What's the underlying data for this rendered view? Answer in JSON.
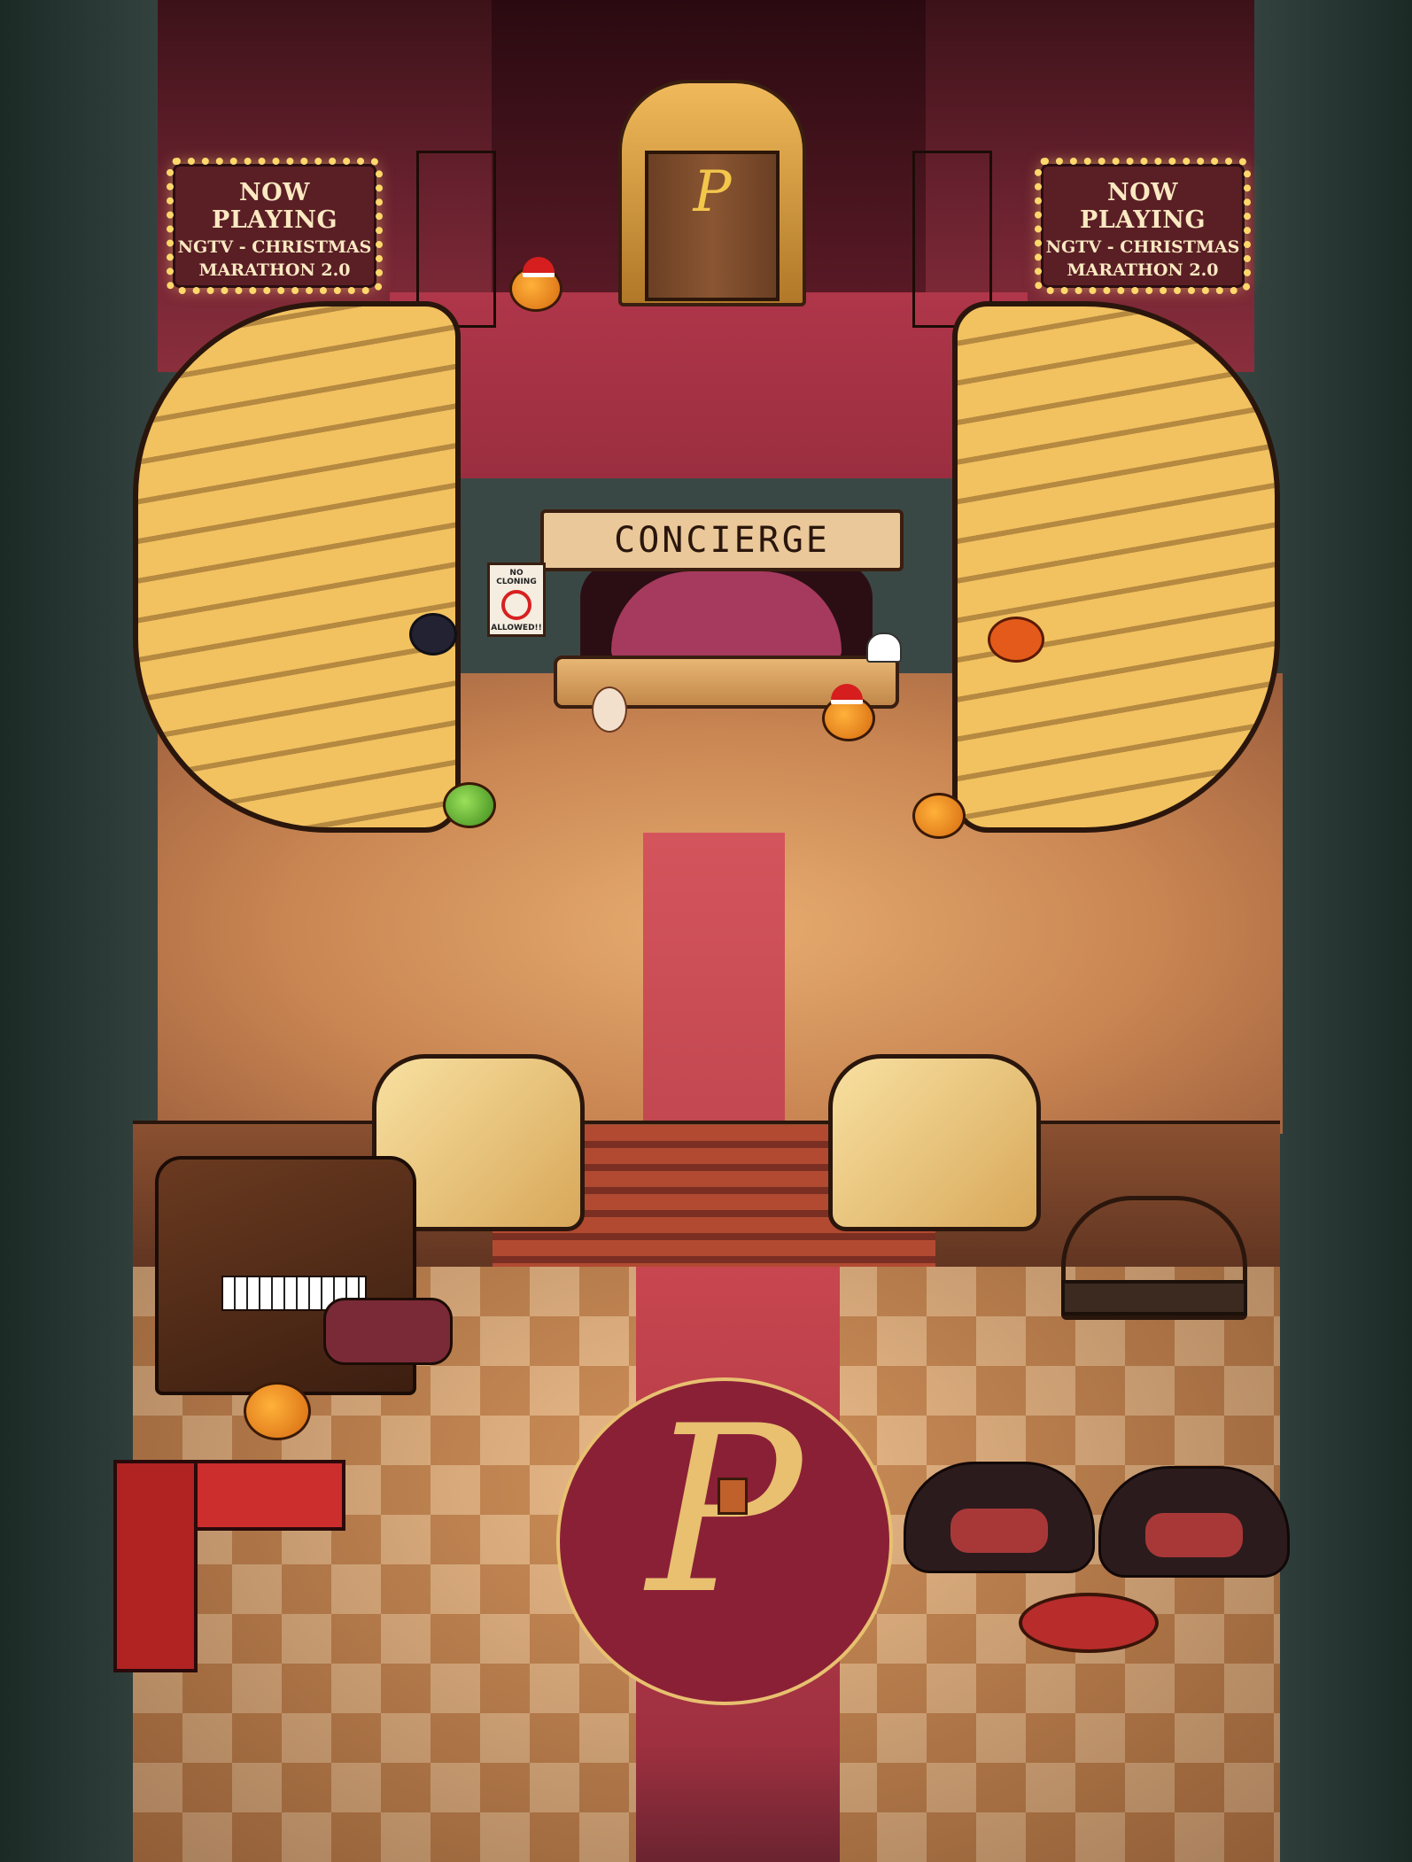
{
  "scene": {
    "type": "hotel lobby game room"
  },
  "marquees": [
    {
      "line1": "NOW PLAYING",
      "line2": "NGTV - CHRISTMAS",
      "line3": "MARATHON 2.0"
    },
    {
      "line1": "NOW PLAYING",
      "line2": "NGTV - CHRISTMAS",
      "line3": "MARATHON 2.0"
    }
  ],
  "concierge": {
    "label": "CONCIERGE"
  },
  "no_cloning_sign": {
    "line1": "NO CLONING",
    "line2": "ALLOWED!!"
  },
  "elevator": {
    "logo": "P"
  },
  "lobby_emblem": {
    "logo": "P"
  },
  "icons": {
    "elevator": "elevator-door-icon",
    "piano": "piano-icon",
    "luggage_cart": "luggage-cart-icon",
    "pumpkin": "jack-o-lantern-icon",
    "spider": "spider-icon",
    "ghost": "ghost-icon",
    "sofa": "sofa-icon"
  },
  "colors": {
    "wall": "#6b2230",
    "carpet": "#c8464f",
    "gold_trim": "#e8c070",
    "floor_light": "#eab786",
    "floor_dark": "#c9854f"
  }
}
